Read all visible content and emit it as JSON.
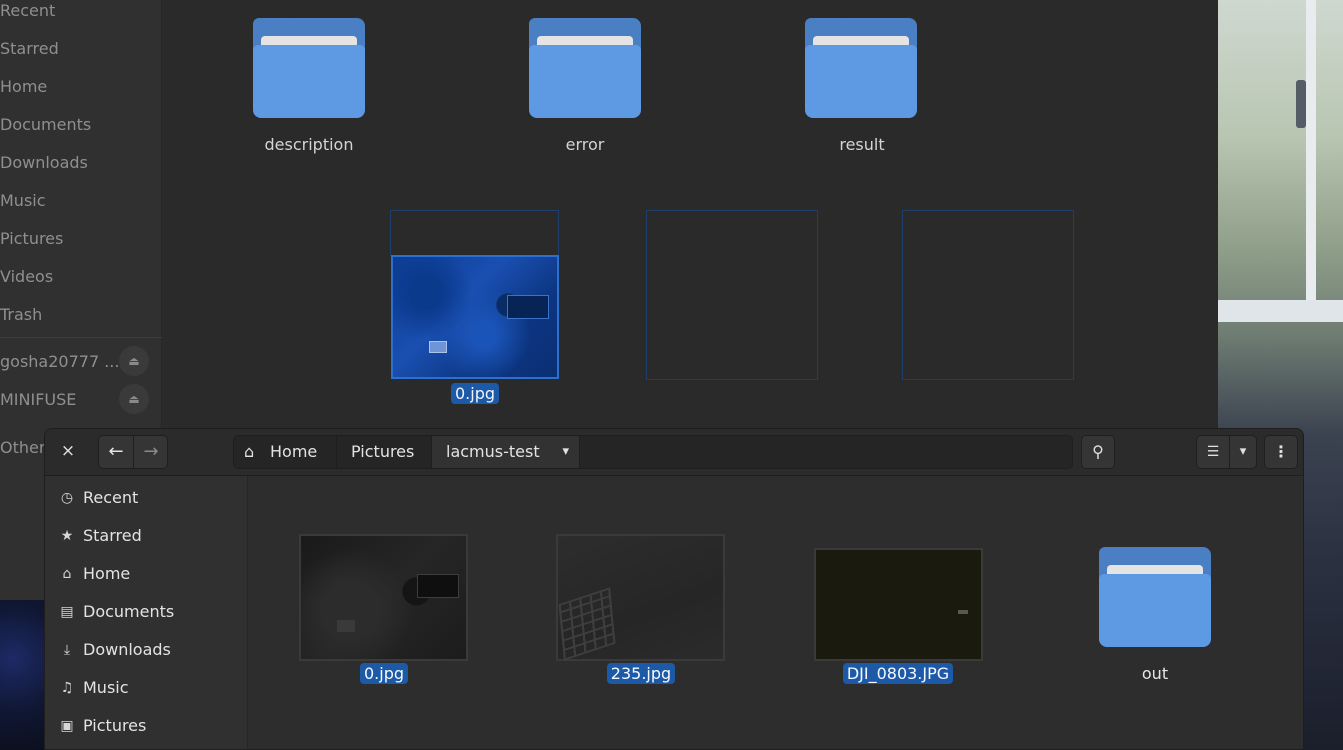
{
  "background_window": {
    "sidebar": {
      "items": [
        "Recent",
        "Starred",
        "Home",
        "Documents",
        "Downloads",
        "Music",
        "Pictures",
        "Videos",
        "Trash"
      ],
      "devices": [
        "gosha20777 ...",
        "MINIFUSE"
      ],
      "other": "Other"
    },
    "folders": [
      "description",
      "error",
      "result"
    ],
    "selected_file": "0.jpg"
  },
  "dialog": {
    "close_glyph": "×",
    "back_glyph": "←",
    "forward_glyph": "→",
    "path": {
      "home": "Home",
      "pictures": "Pictures",
      "current": "lacmus-test",
      "dropdown_glyph": "▾"
    },
    "search_glyph": "⚲",
    "view_glyph": "☰",
    "view_dropdown_glyph": "▾",
    "menu_glyph": "⋮",
    "sidebar": [
      {
        "label": "Recent",
        "icon": "clock-icon",
        "glyph": "◷"
      },
      {
        "label": "Starred",
        "icon": "star-icon",
        "glyph": "★"
      },
      {
        "label": "Home",
        "icon": "home-icon",
        "glyph": "⌂"
      },
      {
        "label": "Documents",
        "icon": "document-icon",
        "glyph": "▤"
      },
      {
        "label": "Downloads",
        "icon": "download-icon",
        "glyph": "⤓"
      },
      {
        "label": "Music",
        "icon": "music-icon",
        "glyph": "♫"
      },
      {
        "label": "Pictures",
        "icon": "image-icon",
        "glyph": "▣"
      }
    ],
    "files": [
      {
        "name": "0.jpg",
        "selected": true
      },
      {
        "name": "235.jpg",
        "selected": true
      },
      {
        "name": "DJI_0803.JPG",
        "selected": true
      },
      {
        "name": "out",
        "selected": false
      }
    ]
  },
  "colors": {
    "accent": "#1c5aa8",
    "folder": "#5d9ae3",
    "background": "#2d2d2d"
  }
}
